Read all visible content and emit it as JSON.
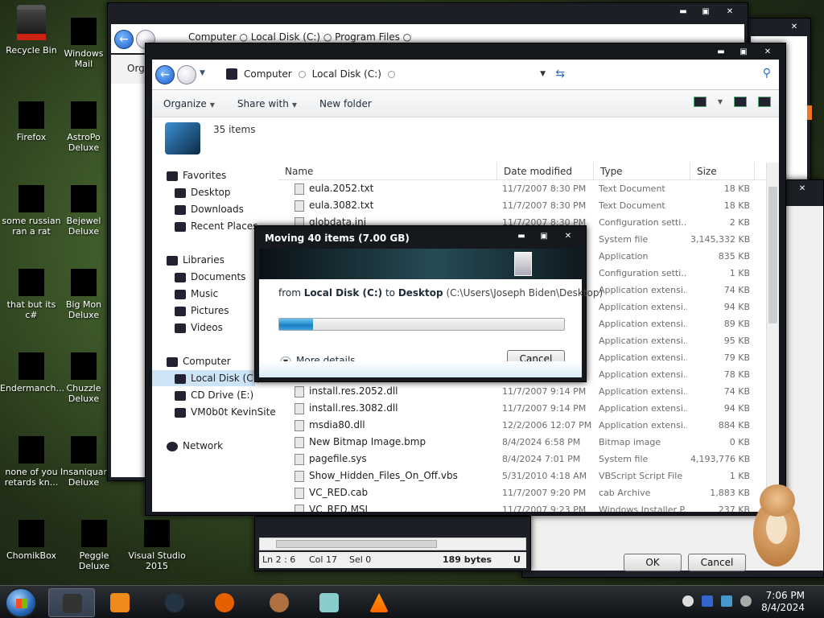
{
  "desktop": {
    "icons": [
      {
        "label": "Recycle Bin"
      },
      {
        "label": "Windows Mail"
      },
      {
        "label": "Firefox"
      },
      {
        "label": "AstroPo Deluxe"
      },
      {
        "label": "some russian ran a rat"
      },
      {
        "label": "Bejewel Deluxe"
      },
      {
        "label": "that but its c#"
      },
      {
        "label": "Big Mon Deluxe"
      },
      {
        "label": "Endermanch..."
      },
      {
        "label": "Chuzzle Deluxe"
      },
      {
        "label": "none of you retards kn..."
      },
      {
        "label": "Insaniquar Deluxe"
      },
      {
        "label": "ChomikBox"
      },
      {
        "label": "Peggle Deluxe"
      },
      {
        "label": "Visual Studio 2015"
      }
    ]
  },
  "back_explorer": {
    "address": "Computer  ○  Local Disk (C:)  ○  Program Files  ○",
    "cmd_label": "Org"
  },
  "front_explorer": {
    "breadcrumb": [
      "Computer",
      "Local Disk (C:)"
    ],
    "toolbar": {
      "organize": "Organize",
      "share": "Share with",
      "new_folder": "New folder"
    },
    "item_count": "35 items",
    "nav": {
      "favorites": "Favorites",
      "desktop": "Desktop",
      "downloads": "Downloads",
      "recent": "Recent Places",
      "libraries": "Libraries",
      "documents": "Documents",
      "music": "Music",
      "pictures": "Pictures",
      "videos": "Videos",
      "computer": "Computer",
      "local_disk": "Local Disk (C:)",
      "cd_drive": "CD Drive (E:)",
      "vm": "VM0b0t KevinSite",
      "network": "Network"
    },
    "columns": {
      "name": "Name",
      "date": "Date modified",
      "type": "Type",
      "size": "Size"
    },
    "files": [
      {
        "name": "eula.2052.txt",
        "date": "11/7/2007 8:30 PM",
        "type": "Text Document",
        "size": "18 KB"
      },
      {
        "name": "eula.3082.txt",
        "date": "11/7/2007 8:30 PM",
        "type": "Text Document",
        "size": "18 KB"
      },
      {
        "name": "globdata.ini",
        "date": "11/7/2007 8:30 PM",
        "type": "Configuration setti...",
        "size": "2 KB"
      },
      {
        "name": "",
        "date": "",
        "type": "System file",
        "size": "3,145,332 KB"
      },
      {
        "name": "",
        "date": "",
        "type": "Application",
        "size": "835 KB"
      },
      {
        "name": "",
        "date": "",
        "type": "Configuration setti...",
        "size": "1 KB"
      },
      {
        "name": "",
        "date": "",
        "type": "Application extensi...",
        "size": "74 KB"
      },
      {
        "name": "",
        "date": "",
        "type": "Application extensi...",
        "size": "94 KB"
      },
      {
        "name": "",
        "date": "",
        "type": "Application extensi...",
        "size": "89 KB"
      },
      {
        "name": "",
        "date": "",
        "type": "Application extensi...",
        "size": "95 KB"
      },
      {
        "name": "",
        "date": "",
        "type": "Application extensi...",
        "size": "79 KB"
      },
      {
        "name": "",
        "date": "",
        "type": "Application extensi...",
        "size": "78 KB"
      },
      {
        "name": "install.res.2052.dll",
        "date": "11/7/2007 9:14 PM",
        "type": "Application extensi...",
        "size": "74 KB"
      },
      {
        "name": "install.res.3082.dll",
        "date": "11/7/2007 9:14 PM",
        "type": "Application extensi...",
        "size": "94 KB"
      },
      {
        "name": "msdia80.dll",
        "date": "12/2/2006 12:07 PM",
        "type": "Application extensi...",
        "size": "884 KB"
      },
      {
        "name": "New Bitmap Image.bmp",
        "date": "8/4/2024 6:58 PM",
        "type": "Bitmap image",
        "size": "0 KB"
      },
      {
        "name": "pagefile.sys",
        "date": "8/4/2024 7:01 PM",
        "type": "System file",
        "size": "4,193,776 KB"
      },
      {
        "name": "Show_Hidden_Files_On_Off.vbs",
        "date": "5/31/2010 4:18 AM",
        "type": "VBScript Script File",
        "size": "1 KB"
      },
      {
        "name": "VC_RED.cab",
        "date": "11/7/2007 9:20 PM",
        "type": "cab Archive",
        "size": "1,883 KB"
      },
      {
        "name": "VC_RED.MSI",
        "date": "11/7/2007 9:23 PM",
        "type": "Windows Installer P...",
        "size": "237 KB"
      }
    ]
  },
  "copy_dialog": {
    "title": "Moving 40 items (7.00 GB)",
    "from_prefix": "from",
    "source": "Local Disk (C:)",
    "to_word": "to",
    "dest": "Desktop",
    "dest_path": "(C:\\Users\\Joseph Biden\\Desktop)",
    "progress_pct": 12,
    "more_details": "More details",
    "cancel": "Cancel"
  },
  "editor": {
    "line_col": "Ln 2 : 6",
    "col": "Col 17",
    "sel": "Sel 0",
    "bytes": "189 bytes",
    "trail": "U"
  },
  "right_dialog": {
    "ok": "OK",
    "cancel": "Cancel"
  },
  "taskbar": {
    "time": "7:06 PM",
    "date": "8/4/2024"
  },
  "colors": {
    "accent": "#1a7fc2",
    "selection": "#cde4f7"
  }
}
